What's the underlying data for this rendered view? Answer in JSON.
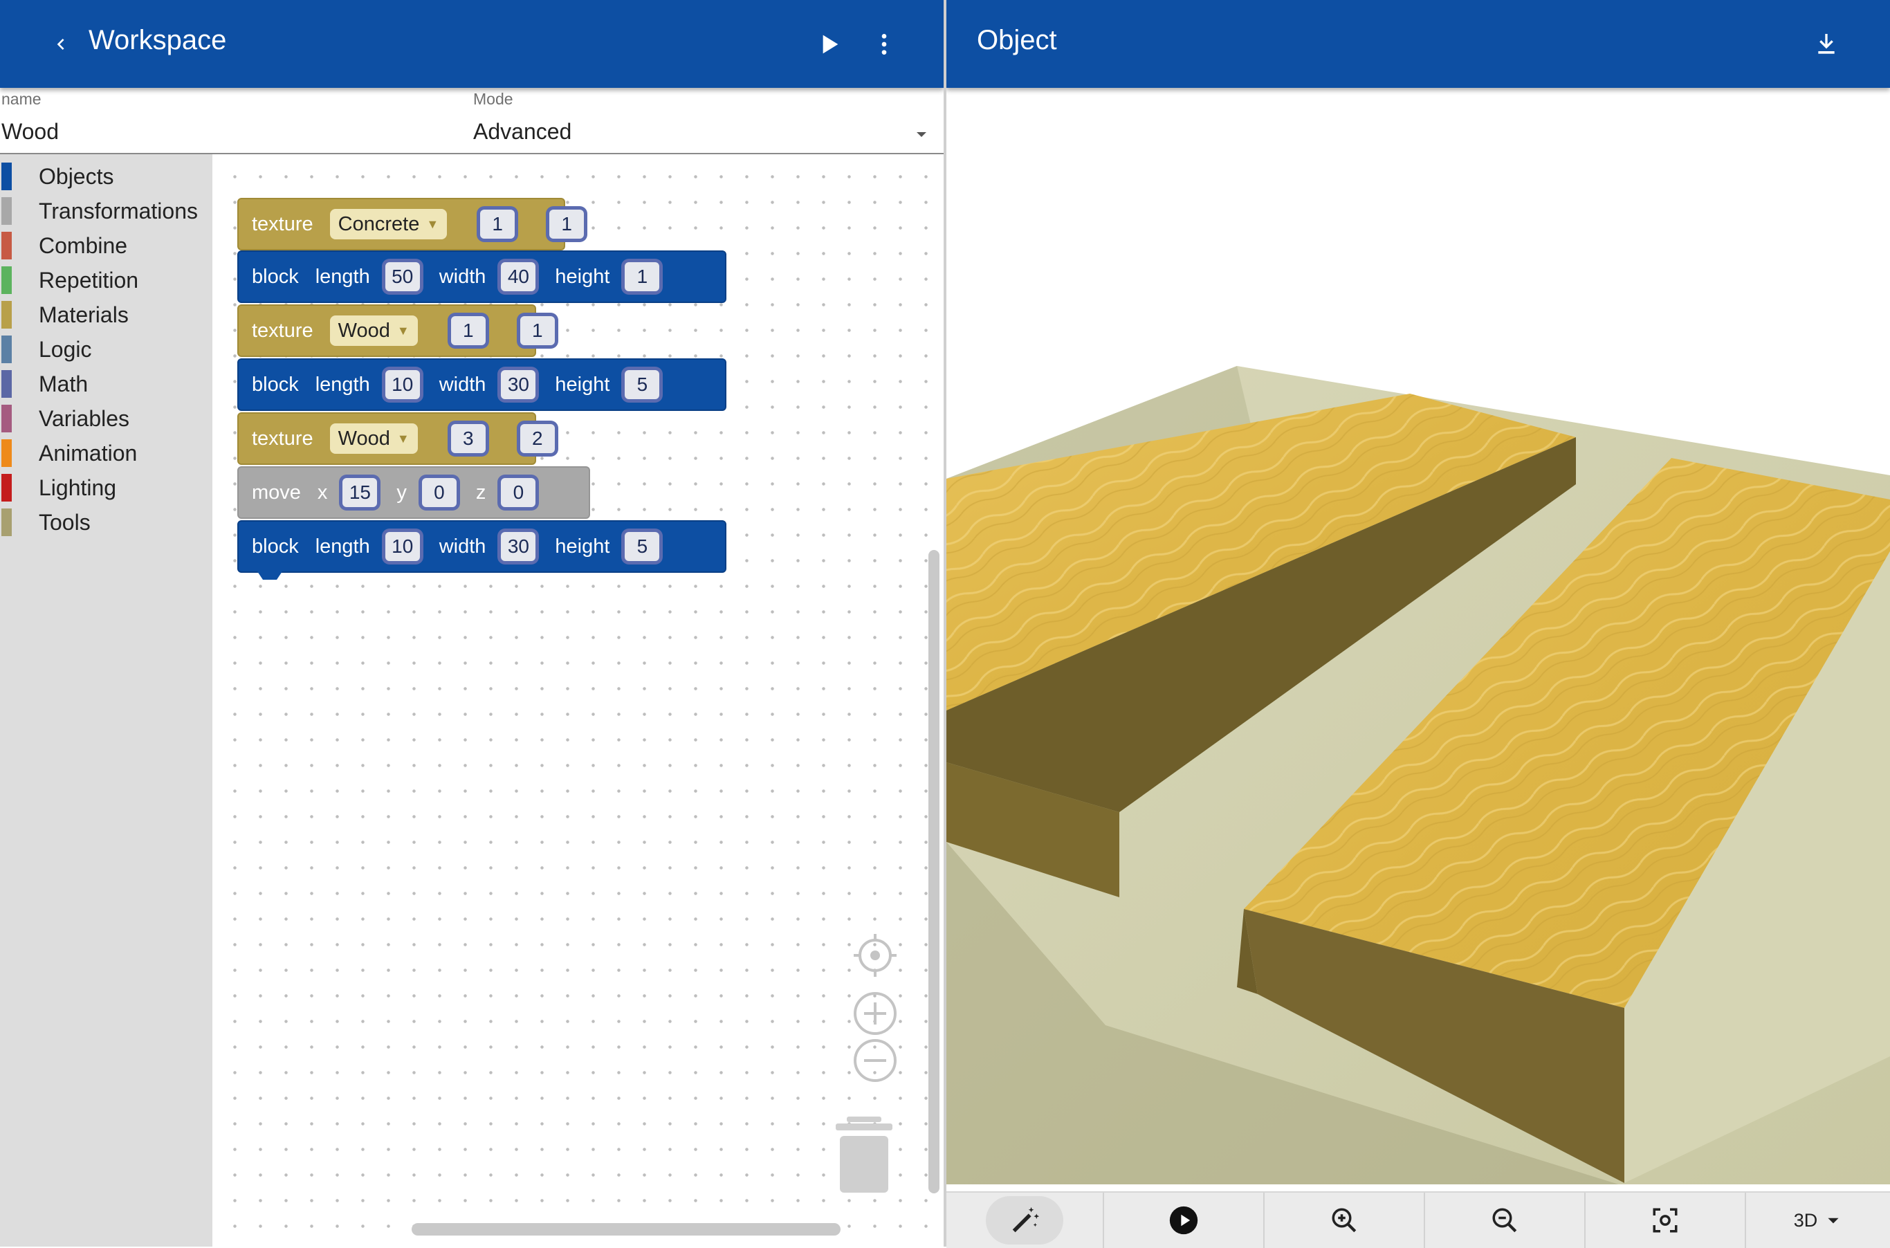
{
  "workspace_header": {
    "back_icon": "chevron-left-icon",
    "title": "Workspace",
    "play_icon": "play-icon",
    "more_icon": "more-vert-icon"
  },
  "object_header": {
    "title": "Object",
    "download_icon": "download-icon"
  },
  "form": {
    "name_label": "name",
    "name_value": "Wood",
    "mode_label": "Mode",
    "mode_value": "Advanced"
  },
  "toolbox": {
    "items": [
      {
        "label": "Objects",
        "color": "#0d4fa3"
      },
      {
        "label": "Transformations",
        "color": "#a8a8a8"
      },
      {
        "label": "Combine",
        "color": "#c75a44"
      },
      {
        "label": "Repetition",
        "color": "#5cb35e"
      },
      {
        "label": "Materials",
        "color": "#b8a04a"
      },
      {
        "label": "Logic",
        "color": "#5b80a5"
      },
      {
        "label": "Math",
        "color": "#5b67a5"
      },
      {
        "label": "Variables",
        "color": "#a55b80"
      },
      {
        "label": "Animation",
        "color": "#ee8a1a"
      },
      {
        "label": "Lighting",
        "color": "#c41d1d"
      },
      {
        "label": "Tools",
        "color": "#a8a070"
      }
    ]
  },
  "blocks": {
    "b1": {
      "kw": "texture",
      "dropdown": "Concrete",
      "u": "1",
      "v": "1"
    },
    "b2": {
      "kw": "block",
      "l_label": "length",
      "length": "50",
      "w_label": "width",
      "width": "40",
      "h_label": "height",
      "height": "1"
    },
    "b3": {
      "kw": "texture",
      "dropdown": "Wood",
      "u": "1",
      "v": "1"
    },
    "b4": {
      "kw": "block",
      "l_label": "length",
      "length": "10",
      "w_label": "width",
      "width": "30",
      "h_label": "height",
      "height": "5"
    },
    "b5": {
      "kw": "texture",
      "dropdown": "Wood",
      "u": "3",
      "v": "2"
    },
    "b6": {
      "kw": "move",
      "x_label": "x",
      "x": "15",
      "y_label": "y",
      "y": "0",
      "z_label": "z",
      "z": "0"
    },
    "b7": {
      "kw": "block",
      "l_label": "length",
      "length": "10",
      "w_label": "width",
      "width": "30",
      "h_label": "height",
      "height": "5"
    }
  },
  "workspace_controls": {
    "center_icon": "recenter-icon",
    "zoom_in_icon": "zoom-in-icon",
    "zoom_out_icon": "zoom-out-icon",
    "trash_icon": "trash-icon"
  },
  "viewer_toolbar": {
    "wand_icon": "magic-wand-icon",
    "play_icon": "play-circle-icon",
    "zoom_in_icon": "zoom-in-icon",
    "zoom_out_icon": "zoom-out-icon",
    "fit_icon": "fit-screen-icon",
    "view_mode": "3D"
  },
  "colors": {
    "header": "#0d4fa3",
    "workspace_bg": "#ffffff",
    "toolbox_bg": "#dddddd",
    "wood": "#e2b94a",
    "concrete": "#d9d9b8"
  }
}
